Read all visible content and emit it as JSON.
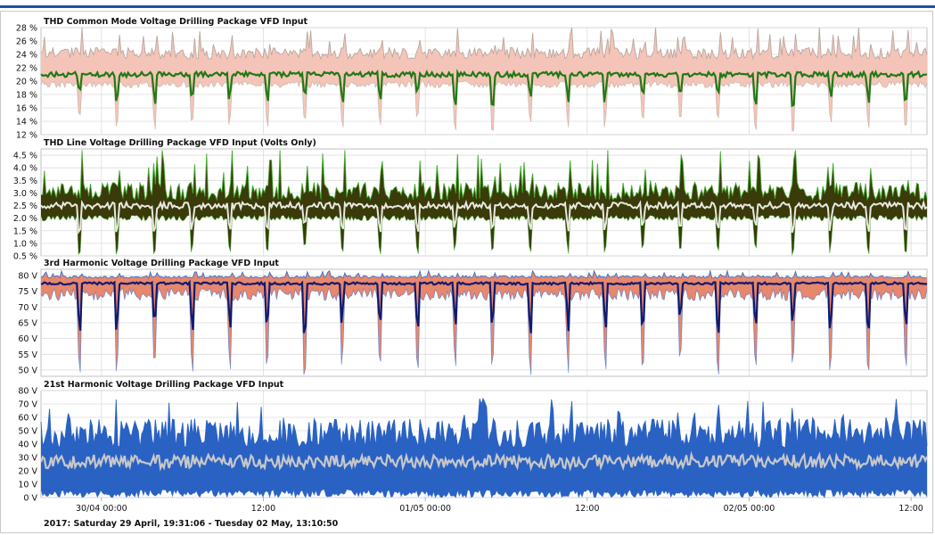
{
  "colors": {
    "grid": "#dcdcdc",
    "axis": "#9a9a9a",
    "thd_cm_band": "#f5c4b8",
    "thd_cm_max_line": "#b7a89f",
    "thd_cm_avg": "#1f7a13",
    "thd_line_band": "#3a3a0a",
    "thd_line_edge": "#3faa2a",
    "thd_line_avg": "#e8e8e0",
    "h3_band": "#e7876c",
    "h3_max_line": "#3a6fd0",
    "h3_avg": "#101a6e",
    "h21_band": "#2a62c4",
    "h21_avg": "#c8c8c8"
  },
  "date_range": "2017: Saturday 29 April, 19:31:06 - Tuesday 02 May, 13:10:50",
  "chart_data": [
    {
      "type": "area",
      "title": "THD Common Mode Voltage Drilling Package VFD Input",
      "unit": "%",
      "ylim": [
        12,
        28
      ],
      "yticks": [
        "12 %",
        "14 %",
        "16 %",
        "18 %",
        "20 %",
        "22 %",
        "24 %",
        "26 %",
        "28 %"
      ],
      "grid": true,
      "x_range": [
        "2017-04-29 19:31:06",
        "2017-05-02 13:10:50"
      ],
      "series": [
        {
          "role": "max",
          "typical": 24,
          "range": [
            22,
            28
          ]
        },
        {
          "role": "average",
          "typical": 21,
          "range": [
            19.5,
            22.5
          ]
        },
        {
          "role": "min",
          "typical": 19.5,
          "range": [
            12.5,
            20
          ]
        }
      ],
      "dips_at": [
        "periodic, approx. every 1.5 h"
      ]
    },
    {
      "type": "area",
      "title": "THD Line Voltage Drilling Package VFD Input (Volts Only)",
      "unit": "%",
      "ylim": [
        0.5,
        4.75
      ],
      "yticks": [
        "0.5 %",
        "1.0 %",
        "1.5 %",
        "2.0 %",
        "2.5 %",
        "3.0 %",
        "3.5 %",
        "4.0 %",
        "4.5 %"
      ],
      "grid": true,
      "x_range": [
        "2017-04-29 19:31:06",
        "2017-05-02 13:10:50"
      ],
      "series": [
        {
          "role": "max",
          "typical": 3.0,
          "range": [
            2.8,
            4.7
          ]
        },
        {
          "role": "average",
          "typical": 2.5,
          "range": [
            1.0,
            3.0
          ]
        },
        {
          "role": "min",
          "typical": 2.0,
          "range": [
            0.5,
            2.2
          ]
        }
      ]
    },
    {
      "type": "area",
      "title": "3rd Harmonic Voltage Drilling Package VFD Input",
      "unit": "V",
      "ylim": [
        48,
        82
      ],
      "yticks": [
        "50 V",
        "55 V",
        "60 V",
        "65 V",
        "70 V",
        "75 V",
        "80 V"
      ],
      "grid": true,
      "x_range": [
        "2017-04-29 19:31:06",
        "2017-05-02 13:10:50"
      ],
      "series": [
        {
          "role": "max",
          "typical": 79.5,
          "range": [
            77,
            81.5
          ]
        },
        {
          "role": "average",
          "typical": 77.5,
          "range": [
            55,
            79
          ]
        },
        {
          "role": "min",
          "typical": 74,
          "range": [
            48,
            76
          ]
        }
      ]
    },
    {
      "type": "area",
      "title": "21st Harmonic Voltage Drilling Package VFD Input",
      "unit": "V",
      "ylim": [
        0,
        80
      ],
      "yticks": [
        "0 V",
        "10 V",
        "20 V",
        "30 V",
        "40 V",
        "50 V",
        "60 V",
        "70 V",
        "80 V"
      ],
      "grid": true,
      "x_range": [
        "2017-04-29 19:31:06",
        "2017-05-02 13:10:50"
      ],
      "series": [
        {
          "role": "max",
          "typical": 48,
          "range": [
            35,
            76
          ]
        },
        {
          "role": "average",
          "typical": 27,
          "range": [
            18,
            40
          ]
        },
        {
          "role": "min",
          "typical": 3,
          "range": [
            0,
            15
          ]
        }
      ]
    }
  ],
  "x_axis": {
    "start": "2017-04-29 19:31:06",
    "end": "2017-05-02 13:10:50",
    "ticks": [
      {
        "label": "30/04 00:00",
        "time": "2017-04-30 00:00"
      },
      {
        "label": "12:00",
        "time": "2017-04-30 12:00"
      },
      {
        "label": "01/05 00:00",
        "time": "2017-05-01 00:00"
      },
      {
        "label": "12:00",
        "time": "2017-05-01 12:00"
      },
      {
        "label": "02/05 00:00",
        "time": "2017-05-02 00:00"
      },
      {
        "label": "12:00",
        "time": "2017-05-02 12:00"
      }
    ]
  }
}
